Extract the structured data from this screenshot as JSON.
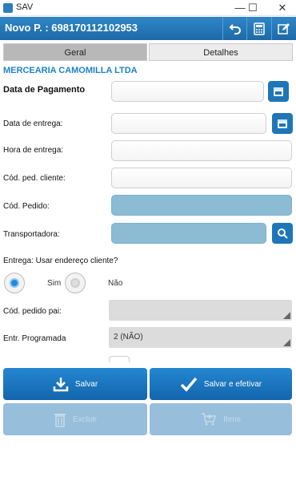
{
  "window": {
    "title": "SAV",
    "minimize": "—",
    "maximize": "☐",
    "close": "✕"
  },
  "appbar": {
    "title": "Novo P. : 698170112102953"
  },
  "tabs": [
    {
      "label": "Geral"
    },
    {
      "label": "Detalhes"
    }
  ],
  "company": "MERCEARIA CAMOMILLA LTDA",
  "fields": {
    "data_pagamento": {
      "label": "Data de Pagamento",
      "value": ""
    },
    "data_entrega": {
      "label": "Data de entrega:",
      "value": ""
    },
    "hora_entrega": {
      "label": "Hora de entrega:",
      "value": ""
    },
    "cod_ped_cliente": {
      "label": "Cód. ped. cliente:",
      "value": ""
    },
    "cod_pedido": {
      "label": "Cód. Pedido:",
      "value": ""
    },
    "transportadora": {
      "label": "Transportadora:",
      "value": ""
    }
  },
  "entrega": {
    "question": "Entrega: Usar endereço cliente?",
    "sim": "Sim",
    "nao": "Não",
    "selected": "Sim"
  },
  "cod_pedido_pai": {
    "label": "Cód. pedido pai:",
    "value": ""
  },
  "entr_programada": {
    "label": "Entr. Programada",
    "value": "2 (NÃO)"
  },
  "buttons": {
    "salvar": "Salvar",
    "salvar_efetivar": "Salvar e efetivar",
    "excluir": "Excluir",
    "itens": "Itens"
  },
  "colors": {
    "primary": "#1e76b8",
    "accent_text": "#1b84c8",
    "readonly_field": "#8bbcd3"
  }
}
